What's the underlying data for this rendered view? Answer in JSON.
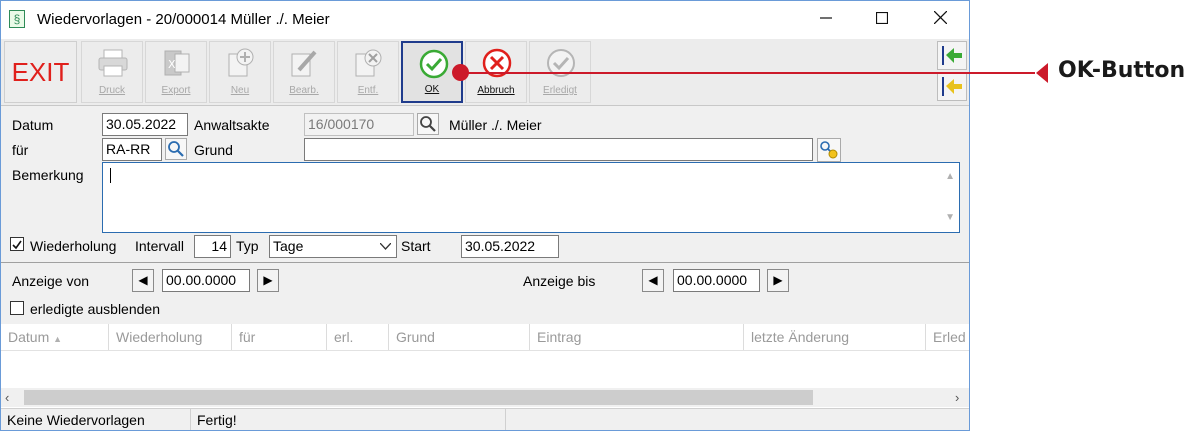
{
  "window": {
    "title": "Wiedervorlagen - 20/000014 Müller ./. Meier"
  },
  "toolbar": {
    "exit": "EXIT",
    "druck": "Druck",
    "export": "Export",
    "neu": "Neu",
    "bearb": "Bearb.",
    "entf": "Entf.",
    "ok": "OK",
    "abbruch": "Abbruch",
    "erledigt": "Erledigt"
  },
  "form": {
    "datum_label": "Datum",
    "datum_value": "30.05.2022",
    "anwaltsakte_label": "Anwaltsakte",
    "anwaltsakte_value": "16/000170",
    "akte_name": "Müller ./. Meier",
    "fuer_label": "für",
    "fuer_value": "RA-RR",
    "grund_label": "Grund",
    "grund_value": "",
    "bemerkung_label": "Bemerkung",
    "bemerkung_value": "",
    "wiederholung_label": "Wiederholung",
    "wiederholung_checked": true,
    "intervall_label": "Intervall",
    "intervall_value": "14",
    "typ_label": "Typ",
    "typ_value": "Tage",
    "start_label": "Start",
    "start_value": "30.05.2022"
  },
  "filter": {
    "anzeige_von_label": "Anzeige von",
    "anzeige_von_value": "00.00.0000",
    "anzeige_bis_label": "Anzeige bis",
    "anzeige_bis_value": "00.00.0000",
    "erledigte_label": "erledigte ausblenden"
  },
  "table": {
    "columns": [
      "Datum",
      "Wiederholung",
      "für",
      "erl.",
      "Grund",
      "Eintrag",
      "letzte Änderung",
      "Erled"
    ]
  },
  "status": {
    "left": "Keine Wiedervorlagen",
    "middle": "Fertig!"
  },
  "annotation": {
    "text": "OK-Button"
  },
  "colors": {
    "exit_red": "#e0201c",
    "ok_green": "#3aaa35",
    "cancel_red": "#e0201c",
    "callout_red": "#cc1a2a"
  }
}
